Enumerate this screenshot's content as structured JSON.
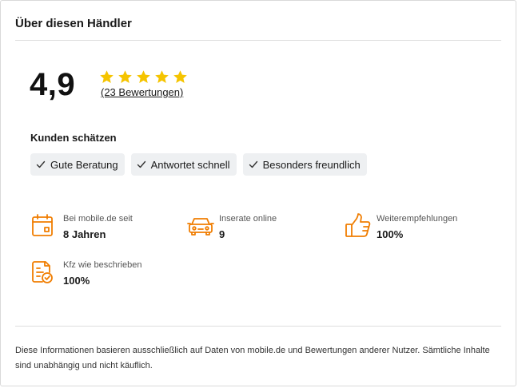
{
  "header": {
    "title": "Über diesen Händler"
  },
  "rating": {
    "value": "4,9",
    "stars": 5,
    "star_color": "#f5c400",
    "reviews_link": "(23 Bewertungen)"
  },
  "customers": {
    "title": "Kunden schätzen",
    "chips": [
      {
        "label": "Gute Beratung",
        "icon": "check-icon"
      },
      {
        "label": "Antwortet schnell",
        "icon": "check-icon"
      },
      {
        "label": "Besonders freundlich",
        "icon": "check-icon"
      }
    ]
  },
  "stats": [
    {
      "icon": "calendar-icon",
      "label": "Bei mobile.de seit",
      "value": "8 Jahren"
    },
    {
      "icon": "car-icon",
      "label": "Inserate online",
      "value": "9"
    },
    {
      "icon": "thumbs-up-icon",
      "label": "Weiterempfehlungen",
      "value": "100%"
    },
    {
      "icon": "document-check-icon",
      "label": "Kfz wie beschrieben",
      "value": "100%"
    }
  ],
  "accent_color": "#f07d00",
  "footer": {
    "text": "Diese Informationen basieren ausschließlich auf Daten von mobile.de und Bewertungen anderer Nutzer. Sämtliche Inhalte sind unabhängig und nicht käuflich."
  }
}
